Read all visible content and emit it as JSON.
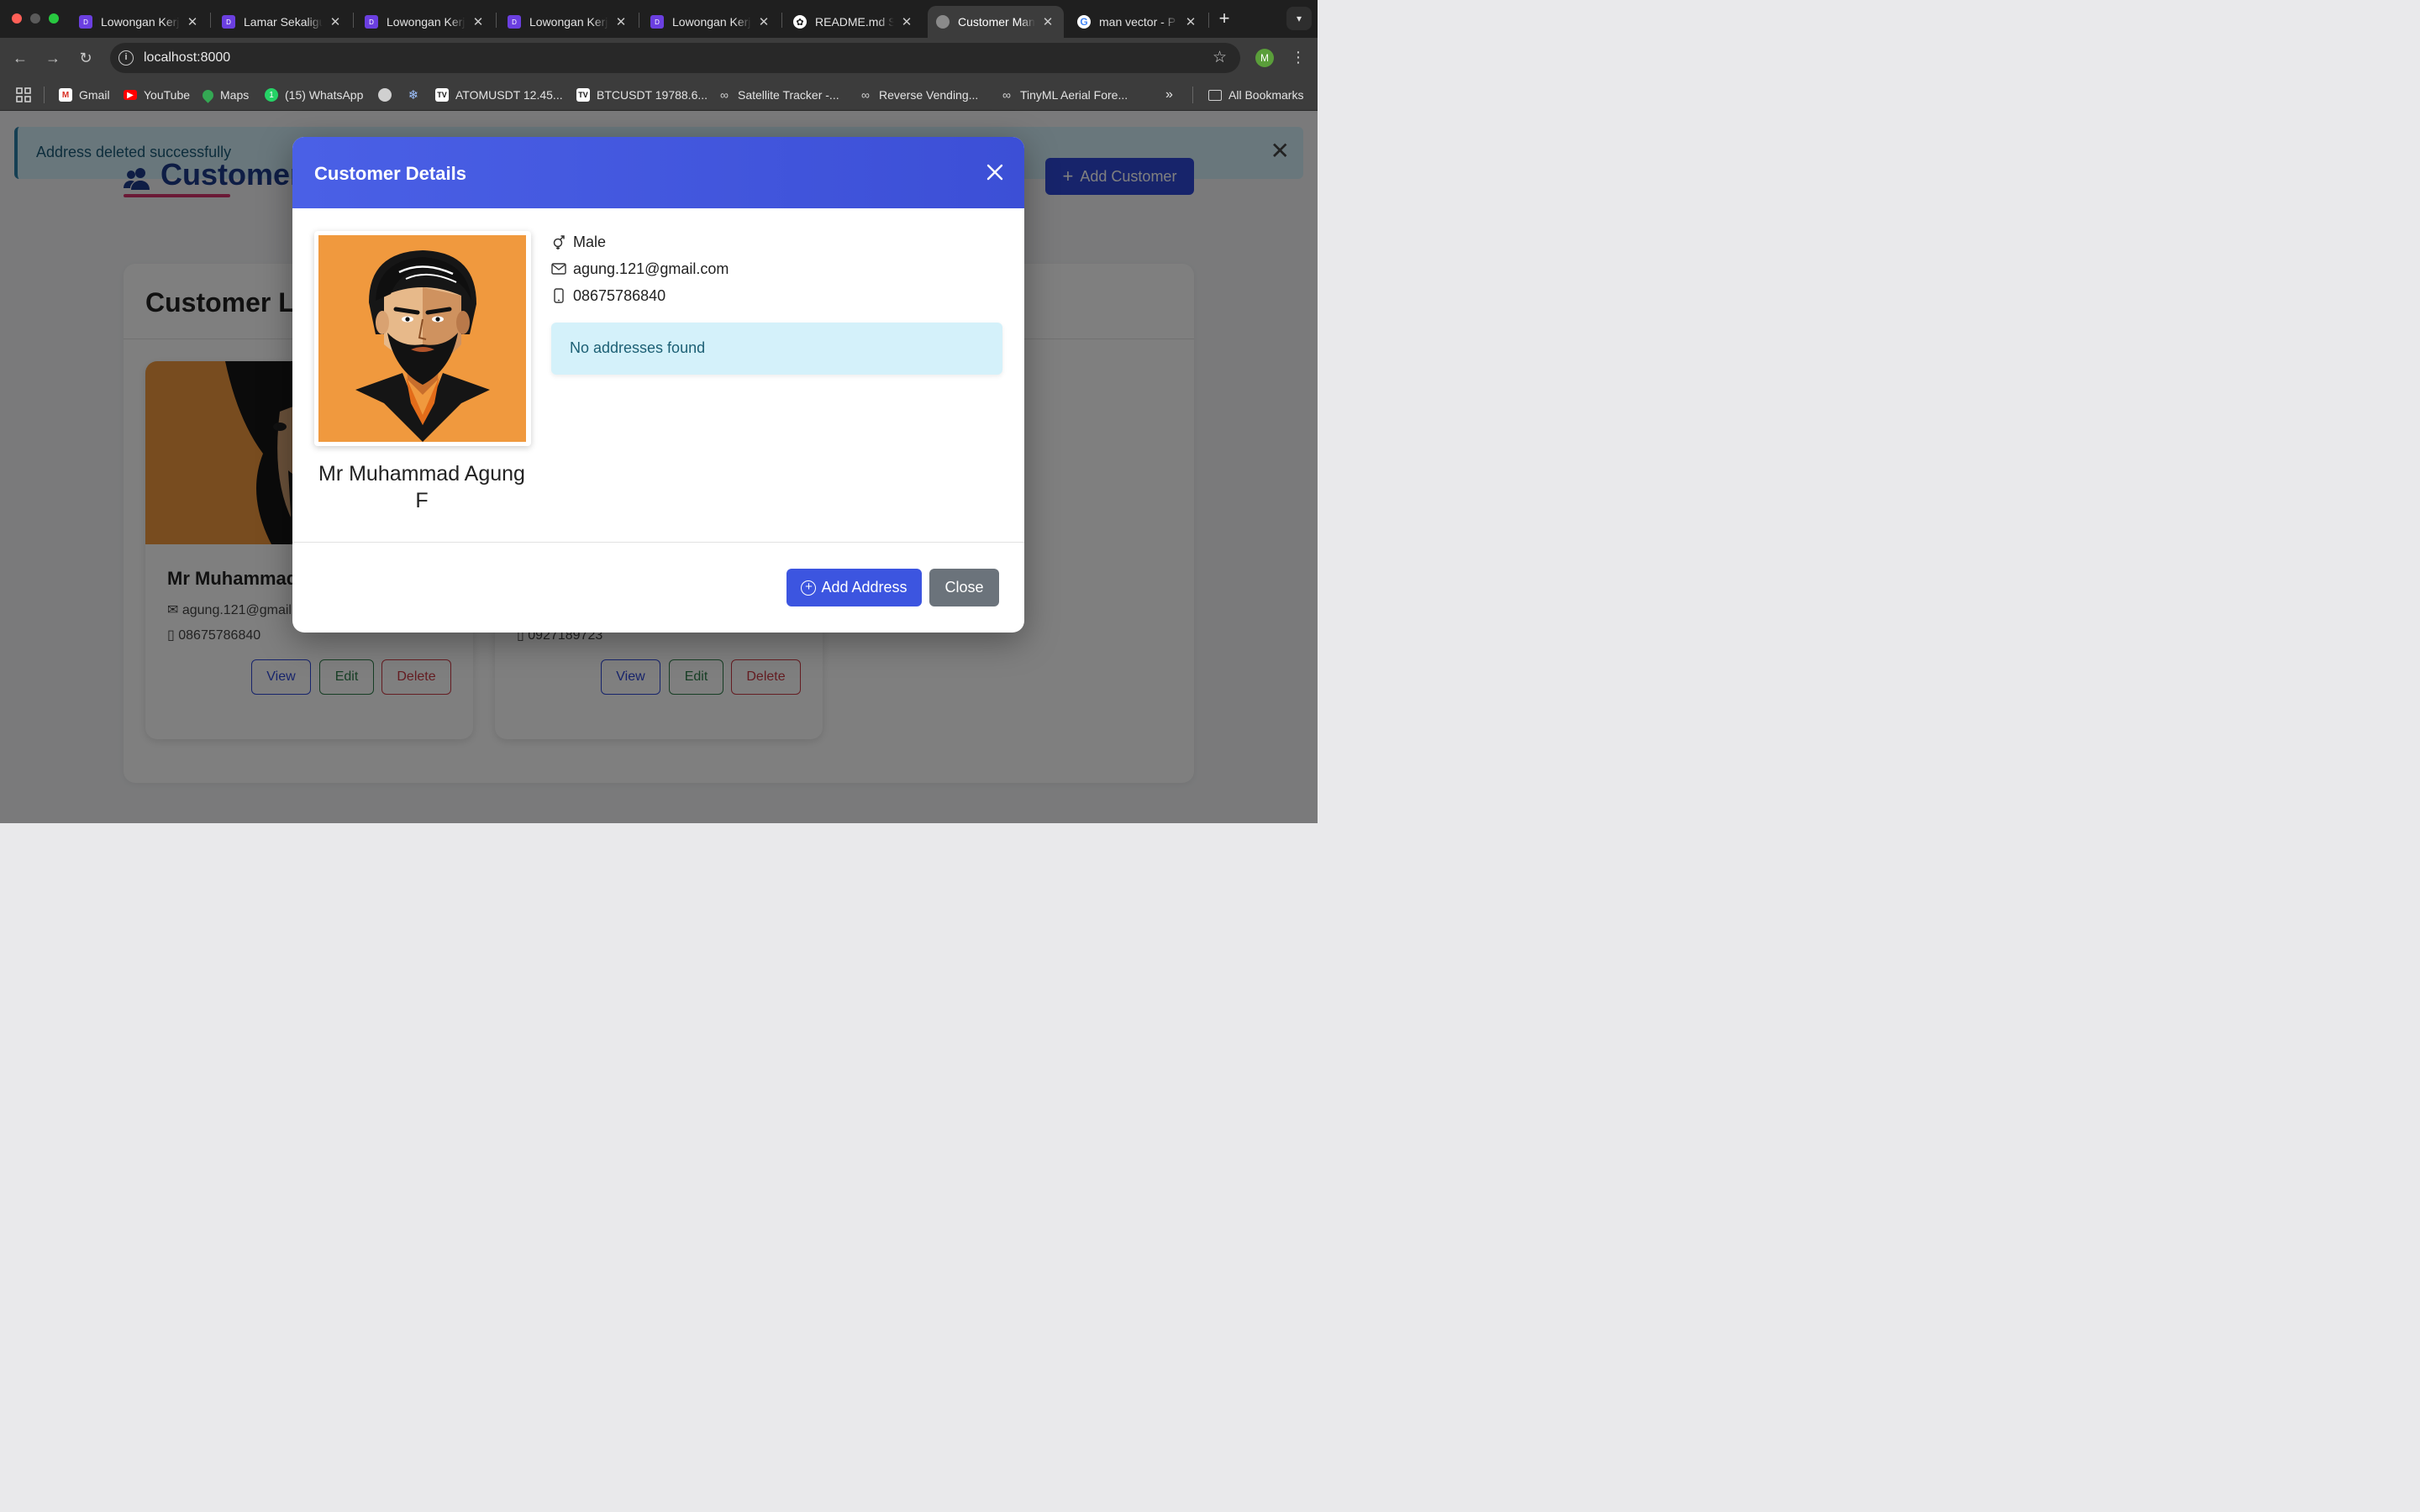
{
  "browser": {
    "tabs": [
      {
        "title": "Lowongan Kerja",
        "icon": "dealls-icon"
      },
      {
        "title": "Lamar Sekaligus",
        "icon": "dealls-icon"
      },
      {
        "title": "Lowongan Kerja",
        "icon": "dealls-icon"
      },
      {
        "title": "Lowongan Kerja",
        "icon": "dealls-icon"
      },
      {
        "title": "Lowongan Kerja",
        "icon": "dealls-icon"
      },
      {
        "title": "README.md St",
        "icon": "openai-icon"
      },
      {
        "title": "Customer Man",
        "icon": "globe-icon",
        "active": true
      },
      {
        "title": "man vector - P",
        "icon": "google-icon"
      }
    ],
    "url": "localhost:8000",
    "profile_initial": "M",
    "bookmarks": [
      {
        "label": "Gmail",
        "icon": "gmail-icon"
      },
      {
        "label": "YouTube",
        "icon": "youtube-icon"
      },
      {
        "label": "Maps",
        "icon": "maps-icon"
      },
      {
        "label": "(15) WhatsApp",
        "icon": "whatsapp-icon"
      },
      {
        "label": "ATOMUSDT 12.45...",
        "icon": "tradingview-icon"
      },
      {
        "label": "BTCUSDT 19788.6...",
        "icon": "tradingview-icon"
      },
      {
        "label": "Satellite Tracker -...",
        "icon": "link-icon"
      },
      {
        "label": "Reverse Vending...",
        "icon": "link-icon"
      },
      {
        "label": "TinyML Aerial Fore...",
        "icon": "link-icon"
      }
    ],
    "all_bookmarks": "All Bookmarks",
    "whatsapp_badge": "1"
  },
  "page": {
    "alert": "Address deleted successfully",
    "title": "Customers",
    "add_customer": "Add Customer",
    "list_title": "Customer List",
    "cards": [
      {
        "name": "Mr Muhammad Agung F",
        "email": "agung.121@gmail.com",
        "phone": "08675786840",
        "view": "View",
        "edit": "Edit",
        "delete": "Delete"
      },
      {
        "name": "",
        "email": "",
        "phone": "0927189723",
        "view": "View",
        "edit": "Edit",
        "delete": "Delete"
      }
    ]
  },
  "modal": {
    "title": "Customer Details",
    "name": "Mr Muhammad Agung F",
    "gender": "Male",
    "email": "agung.121@gmail.com",
    "phone": "08675786840",
    "no_address": "No addresses found",
    "add_address": "Add Address",
    "close": "Close"
  },
  "colors": {
    "primary": "#3c55e0",
    "header_gradient": "#4a60e6",
    "avatar_bg": "#f0993e",
    "info_bg": "#d4f1fa",
    "secondary": "#6b737b"
  }
}
